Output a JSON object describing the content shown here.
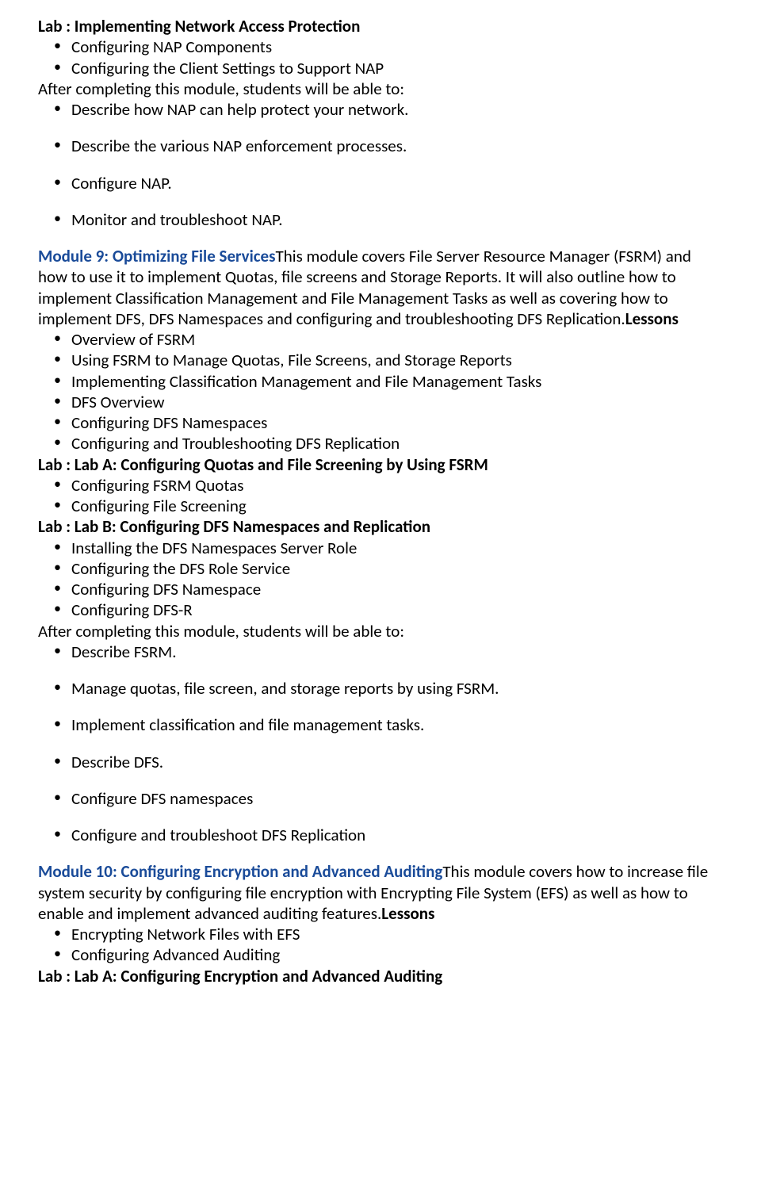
{
  "lab_nap_title": "Lab : Implementing Network Access Protection",
  "lab_nap_items": [
    "Configuring NAP Components",
    "Configuring the Client Settings to Support NAP"
  ],
  "after_module_1": "After completing this module, students will be able to:",
  "abilities_1": [
    "Describe how NAP can help protect your network.",
    "Describe the various NAP enforcement processes.",
    "Configure NAP.",
    "Monitor and troubleshoot NAP."
  ],
  "module9_title": "Module 9: Optimizing File Services",
  "module9_body": "This module covers File Server Resource Manager (FSRM) and how to use it to implement Quotas, file screens and Storage Reports. It will also outline how to implement Classification Management and File Management Tasks as well as covering how to implement DFS, DFS Namespaces and configuring and troubleshooting DFS Replication.",
  "lessons_label": "Lessons",
  "module9_lessons": [
    "Overview of FSRM",
    "Using FSRM to Manage Quotas, File Screens, and Storage Reports",
    "Implementing Classification Management and File Management Tasks",
    "DFS Overview",
    "Configuring DFS Namespaces",
    "Configuring and Troubleshooting DFS Replication"
  ],
  "labA_title": "Lab : Lab A: Configuring Quotas and File Screening by Using FSRM",
  "labA_items": [
    "Configuring FSRM Quotas",
    "Configuring File Screening"
  ],
  "labB_title": "Lab : Lab B: Configuring DFS Namespaces and Replication",
  "labB_items": [
    "Installing the DFS Namespaces Server Role",
    "Configuring the DFS Role Service",
    "Configuring DFS Namespace",
    "Configuring DFS-R"
  ],
  "after_module_2": "After completing this module, students will be able to:",
  "abilities_2": [
    "Describe FSRM.",
    "Manage quotas, file screen, and storage reports by using FSRM.",
    "Implement classification and file management tasks.",
    "Describe DFS.",
    "Configure DFS namespaces",
    "Configure and troubleshoot DFS Replication"
  ],
  "module10_title": "Module 10: Configuring Encryption and Advanced Auditing",
  "module10_body": "This module covers how to increase file system security by configuring file encryption with Encrypting File System (EFS) as well as how to enable and implement advanced auditing features.",
  "module10_lessons": [
    "Encrypting Network Files with EFS",
    "Configuring Advanced Auditing"
  ],
  "labA2_title": "Lab : Lab A: Configuring Encryption and Advanced Auditing"
}
